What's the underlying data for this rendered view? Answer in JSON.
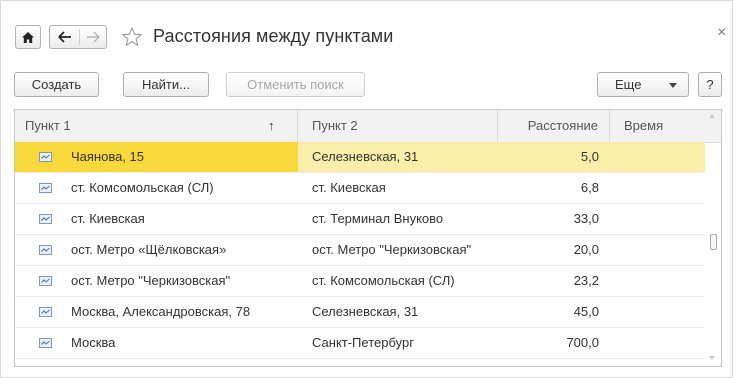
{
  "window": {
    "title": "Расстояния между пунктами",
    "close_glyph": "×"
  },
  "nav": {
    "home_icon": "home-icon",
    "back_icon": "arrow-left-icon",
    "forward_icon": "arrow-right-icon",
    "favorite_icon": "star-outline-icon"
  },
  "toolbar": {
    "create_label": "Создать",
    "find_label": "Найти...",
    "cancel_search_label": "Отменить поиск",
    "more_label": "Еще",
    "help_label": "?"
  },
  "table": {
    "columns": [
      "Пункт 1",
      "Пункт 2",
      "Расстояние",
      "Время"
    ],
    "sort_indicator": "↑",
    "rows": [
      {
        "from": "Чаянова, 15",
        "to": "Селезневская, 31",
        "distance": "5,0",
        "time": "",
        "selected": true
      },
      {
        "from": "ст. Комсомольская (СЛ)",
        "to": "ст. Киевская",
        "distance": "6,8",
        "time": ""
      },
      {
        "from": "ст. Киевская",
        "to": "ст. Терминал Внуково",
        "distance": "33,0",
        "time": ""
      },
      {
        "from": "ост. Метро «Щёлковская»",
        "to": "ост. Метро \"Черкизовская\"",
        "distance": "20,0",
        "time": ""
      },
      {
        "from": "ост. Метро \"Черкизовская\"",
        "to": "ст. Комсомольская (СЛ)",
        "distance": "23,2",
        "time": ""
      },
      {
        "from": "Москва, Александровская, 78",
        "to": "Селезневская, 31",
        "distance": "45,0",
        "time": ""
      },
      {
        "from": "Москва",
        "to": "Санкт-Петербург",
        "distance": "700,0",
        "time": ""
      }
    ],
    "row_icon": "catalog-item-icon"
  },
  "colors": {
    "selected_row": "#faeea9",
    "selected_cell": "#f9d83c"
  }
}
